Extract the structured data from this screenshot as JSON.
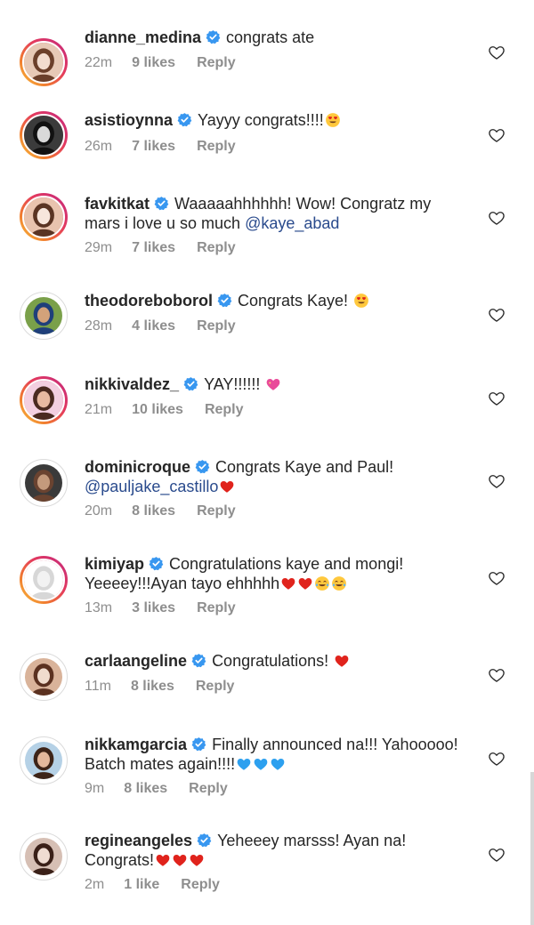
{
  "colors": {
    "verified": "#3897f0",
    "mention": "#2a4b8d",
    "meta": "#8e8e8e",
    "story_ring": [
      "#f9c23c",
      "#e43a5e",
      "#c2287f"
    ]
  },
  "comments": [
    {
      "username": "dianne_medina",
      "lines": [
        [
          {
            "text": "congrats ate"
          }
        ]
      ],
      "time": "22m",
      "likes": "9 likes",
      "reply": "Reply",
      "avatar_ring": true
    },
    {
      "username": "asistioynna",
      "lines": [
        [
          {
            "text": "Yayyy congrats!!!!"
          },
          {
            "emoji": "smiling-heart-eyes-emoji"
          }
        ]
      ],
      "time": "26m",
      "likes": "7 likes",
      "reply": "Reply",
      "avatar_ring": true
    },
    {
      "username": "favkitkat",
      "lines": [
        [
          {
            "text": "Waaaaahhhhhh! Wow! Congratz my"
          }
        ],
        [
          {
            "text": "mars i love u so much "
          },
          {
            "mention": "@kaye_abad"
          }
        ]
      ],
      "time": "29m",
      "likes": "7 likes",
      "reply": "Reply",
      "avatar_ring": true
    },
    {
      "username": "theodoreboborol",
      "lines": [
        [
          {
            "text": "Congrats Kaye! "
          },
          {
            "emoji": "smiling-heart-eyes-emoji"
          }
        ]
      ],
      "time": "28m",
      "likes": "4 likes",
      "reply": "Reply",
      "avatar_ring": false
    },
    {
      "username": "nikkivaldez_",
      "lines": [
        [
          {
            "text": "YAY!!!!!! "
          },
          {
            "emoji": "sparkling-heart-emoji"
          }
        ]
      ],
      "time": "21m",
      "likes": "10 likes",
      "reply": "Reply",
      "avatar_ring": true
    },
    {
      "username": "dominicroque",
      "lines": [
        [
          {
            "text": "Congrats Kaye and Paul!"
          }
        ],
        [
          {
            "mention": "@pauljake_castillo"
          },
          {
            "emoji": "red-heart-emoji"
          }
        ]
      ],
      "time": "20m",
      "likes": "8 likes",
      "reply": "Reply",
      "avatar_ring": false
    },
    {
      "username": "kimiyap",
      "lines": [
        [
          {
            "text": "Congratulations kaye and mongi!"
          }
        ],
        [
          {
            "text": "Yeeeey!!!Ayan tayo ehhhhh"
          },
          {
            "emoji": "red-heart-emoji"
          },
          {
            "emoji": "red-heart-emoji"
          },
          {
            "emoji": "tears-of-joy-emoji"
          },
          {
            "emoji": "tears-of-joy-emoji"
          }
        ]
      ],
      "time": "13m",
      "likes": "3 likes",
      "reply": "Reply",
      "avatar_ring": true
    },
    {
      "username": "carlaangeline",
      "lines": [
        [
          {
            "text": "Congratulations! "
          },
          {
            "emoji": "red-heart-emoji"
          }
        ]
      ],
      "time": "11m",
      "likes": "8 likes",
      "reply": "Reply",
      "avatar_ring": false
    },
    {
      "username": "nikkamgarcia",
      "lines": [
        [
          {
            "text": "Finally announced na!!! Yahooooo!"
          }
        ],
        [
          {
            "text": "Batch mates again!!!!"
          },
          {
            "emoji": "blue-heart-emoji"
          },
          {
            "emoji": "blue-heart-emoji"
          },
          {
            "emoji": "blue-heart-emoji"
          }
        ]
      ],
      "time": "9m",
      "likes": "8 likes",
      "reply": "Reply",
      "avatar_ring": false
    },
    {
      "username": "regineangeles",
      "lines": [
        [
          {
            "text": "Yeheeey marsss! Ayan na!"
          }
        ],
        [
          {
            "text": "Congrats!"
          },
          {
            "emoji": "red-heart-emoji"
          },
          {
            "emoji": "red-heart-emoji"
          },
          {
            "emoji": "red-heart-emoji"
          }
        ]
      ],
      "time": "2m",
      "likes": "1 like",
      "reply": "Reply",
      "avatar_ring": false
    }
  ]
}
